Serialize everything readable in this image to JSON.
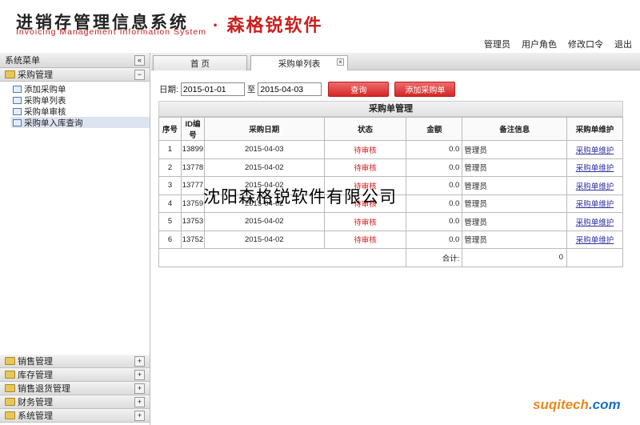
{
  "header": {
    "title_cn": "进销存管理信息系统",
    "title_en": "Invoicing Management Information System",
    "brand": "· 森格锐软件",
    "links": [
      "管理员",
      "用户角色",
      "修改口令",
      "退出"
    ]
  },
  "sidebar": {
    "title": "系统菜单",
    "collapse": "«",
    "active_group": {
      "label": "采购管理",
      "toggle": "−",
      "items": [
        "添加采购单",
        "采购单列表",
        "采购单审核",
        "采购单入库查询"
      ]
    },
    "groups": [
      {
        "label": "销售管理",
        "toggle": "+"
      },
      {
        "label": "库存管理",
        "toggle": "+"
      },
      {
        "label": "销售退货管理",
        "toggle": "+"
      },
      {
        "label": "财务管理",
        "toggle": "+"
      },
      {
        "label": "系统管理",
        "toggle": "+"
      }
    ]
  },
  "tabs": [
    {
      "label": "首 页"
    },
    {
      "label": "采购单列表"
    }
  ],
  "filter": {
    "date_label": "日期:",
    "from": "2015-01-01",
    "to_label": "至",
    "to": "2015-04-03",
    "query": "查询",
    "add": "添加采购单"
  },
  "table": {
    "title": "采购单管理",
    "headers": [
      "序号",
      "ID编号",
      "采购日期",
      "状态",
      "金额",
      "备注信息",
      "采购单维护"
    ],
    "rows": [
      {
        "n": "1",
        "id": "13899",
        "date": "2015-04-03",
        "status": "待审核",
        "amt": "0.0",
        "note": "管理员",
        "op": "采购单维护"
      },
      {
        "n": "2",
        "id": "13778",
        "date": "2015-04-02",
        "status": "待审核",
        "amt": "0.0",
        "note": "管理员",
        "op": "采购单维护"
      },
      {
        "n": "3",
        "id": "13777",
        "date": "2015-04-02",
        "status": "待审核",
        "amt": "0.0",
        "note": "管理员",
        "op": "采购单维护"
      },
      {
        "n": "4",
        "id": "13759",
        "date": "2015-04-02",
        "status": "待审核",
        "amt": "0.0",
        "note": "管理员",
        "op": "采购单维护"
      },
      {
        "n": "5",
        "id": "13753",
        "date": "2015-04-02",
        "status": "待审核",
        "amt": "0.0",
        "note": "管理员",
        "op": "采购单维护"
      },
      {
        "n": "6",
        "id": "13752",
        "date": "2015-04-02",
        "status": "待审核",
        "amt": "0.0",
        "note": "管理员",
        "op": "采购单维护"
      }
    ],
    "total_label": "合计:",
    "total": "0"
  },
  "overlay_text": "沈阳森格锐软件有限公司",
  "watermark": {
    "a": "suqitech",
    "b": ".com"
  }
}
